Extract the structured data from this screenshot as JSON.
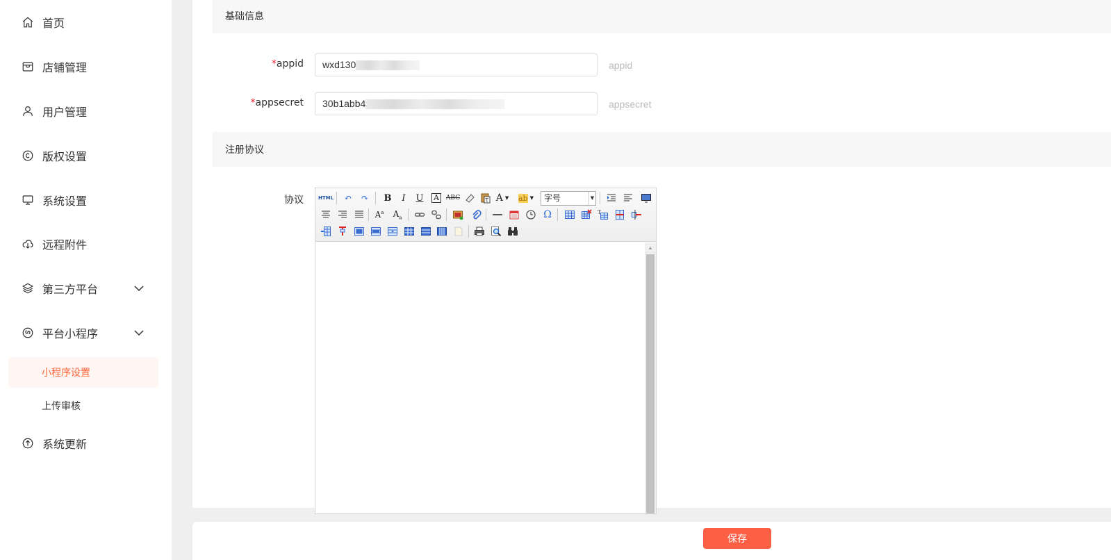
{
  "sidebar": {
    "items": [
      {
        "label": "首页",
        "icon": "home-icon"
      },
      {
        "label": "店铺管理",
        "icon": "store-icon"
      },
      {
        "label": "用户管理",
        "icon": "user-icon"
      },
      {
        "label": "版权设置",
        "icon": "copyright-icon"
      },
      {
        "label": "系统设置",
        "icon": "monitor-icon"
      },
      {
        "label": "远程附件",
        "icon": "cloud-download-icon"
      },
      {
        "label": "第三方平台",
        "icon": "layers-icon"
      },
      {
        "label": "平台小程序",
        "icon": "miniprogram-icon"
      },
      {
        "label": "系统更新",
        "icon": "arrow-up-circle-icon"
      }
    ],
    "sub_items": [
      {
        "label": "小程序设置",
        "active": true
      },
      {
        "label": "上传审核",
        "active": false
      }
    ]
  },
  "form": {
    "basic_section_title": "基础信息",
    "appid": {
      "label": "appid",
      "required_mark": "*",
      "value_visible": "wxd130",
      "hint": "appid"
    },
    "appsecret": {
      "label": "appsecret",
      "required_mark": "*",
      "value_visible": "30b1abb4",
      "hint": "appsecret"
    },
    "agreement_section_title": "注册协议",
    "agreement_label": "协议"
  },
  "editor": {
    "font_size_placeholder": "字号",
    "html_button_label": "HTML"
  },
  "footer": {
    "save_label": "保存"
  },
  "colors": {
    "accent": "#fb6045",
    "active_text": "#fb6638",
    "required": "#f5222d"
  }
}
